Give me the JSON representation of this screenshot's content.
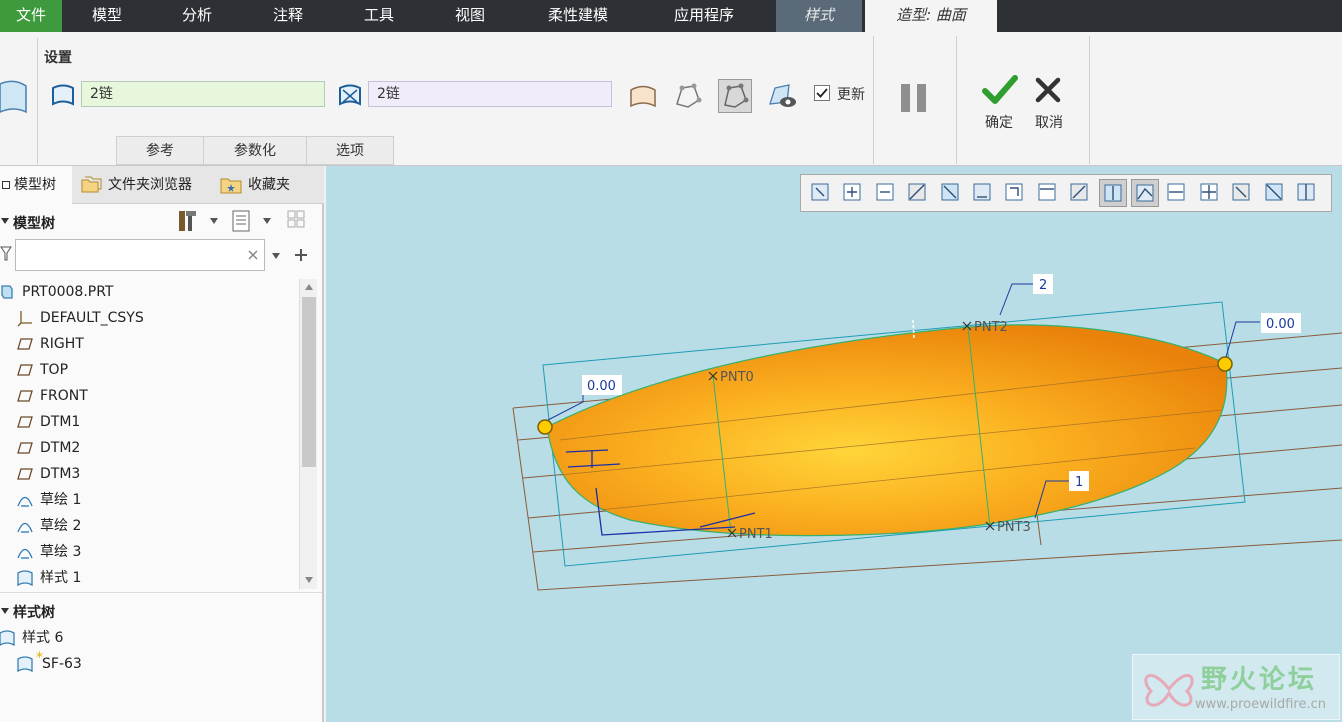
{
  "menubar": {
    "items": [
      "文件",
      "模型",
      "分析",
      "注释",
      "工具",
      "视图",
      "柔性建模",
      "应用程序",
      "样式",
      "造型: 曲面"
    ]
  },
  "ribbon": {
    "settings_label": "设置",
    "chain1_value": "2链",
    "chain2_value": "2链",
    "update_label": "更新",
    "update_checked": true,
    "tabs": [
      "参考",
      "参数化",
      "选项"
    ],
    "ok_label": "确定",
    "cancel_label": "取消"
  },
  "left_panel": {
    "tabs": [
      "模型树",
      "文件夹浏览器",
      "收藏夹"
    ],
    "model_tree_title": "模型树",
    "search_value": "",
    "model_items": [
      {
        "label": "PRT0008.PRT",
        "icon": "part-icon"
      },
      {
        "label": "DEFAULT_CSYS",
        "icon": "csys-icon"
      },
      {
        "label": "RIGHT",
        "icon": "datum-plane-icon"
      },
      {
        "label": "TOP",
        "icon": "datum-plane-icon"
      },
      {
        "label": "FRONT",
        "icon": "datum-plane-icon"
      },
      {
        "label": "DTM1",
        "icon": "datum-plane-icon"
      },
      {
        "label": "DTM2",
        "icon": "datum-plane-icon"
      },
      {
        "label": "DTM3",
        "icon": "datum-plane-icon"
      },
      {
        "label": "草绘 1",
        "icon": "sketch-icon"
      },
      {
        "label": "草绘 2",
        "icon": "sketch-icon"
      },
      {
        "label": "草绘 3",
        "icon": "sketch-icon"
      },
      {
        "label": "样式 1",
        "icon": "style-icon"
      }
    ],
    "style_tree_title": "样式树",
    "style_items": [
      {
        "label": "样式 6",
        "icon": "style-icon"
      },
      {
        "label": "SF-63",
        "icon": "surface-icon"
      }
    ]
  },
  "viewport": {
    "dimensions": [
      "0.00",
      "0.00",
      "2",
      "1"
    ],
    "points": [
      "PNT0",
      "PNT1",
      "PNT2",
      "PNT3"
    ],
    "surface_color": "#f59a0e",
    "background_color": "#b9dde6",
    "watermark_title": "野火论坛",
    "watermark_url": "www.proewildfire.cn"
  }
}
